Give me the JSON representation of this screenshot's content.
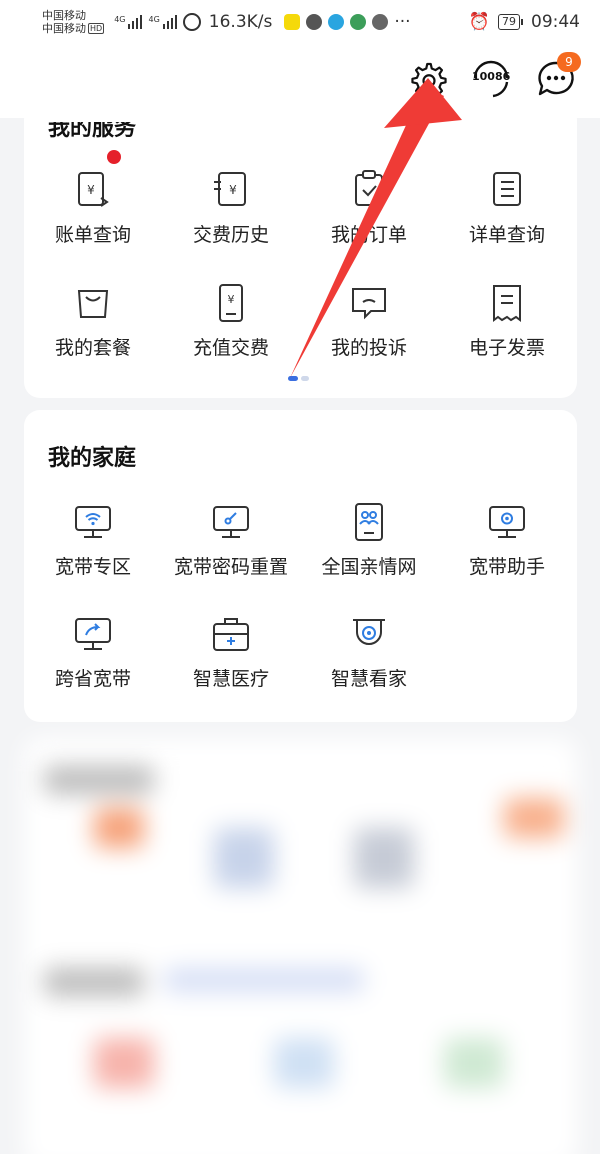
{
  "status_bar": {
    "carrier_1": "中国移动",
    "carrier_2": "中国移动",
    "hd_badge": "HD",
    "network_tag_1": "4G",
    "network_tag_2": "4G",
    "net_speed": "16.3K/s",
    "more": "···",
    "battery": "79",
    "time": "09:44"
  },
  "header": {
    "settings_icon": "gear-icon",
    "service_number": "10086",
    "message_badge": "9"
  },
  "my_services": {
    "title": "我的服务",
    "items": [
      {
        "label": "账单查询",
        "icon": "bill-icon"
      },
      {
        "label": "交费历史",
        "icon": "payment-history-icon"
      },
      {
        "label": "我的订单",
        "icon": "order-icon"
      },
      {
        "label": "详单查询",
        "icon": "detail-list-icon"
      },
      {
        "label": "我的套餐",
        "icon": "package-icon"
      },
      {
        "label": "充值交费",
        "icon": "recharge-icon"
      },
      {
        "label": "我的投诉",
        "icon": "complaint-icon"
      },
      {
        "label": "电子发票",
        "icon": "invoice-icon"
      }
    ]
  },
  "my_family": {
    "title": "我的家庭",
    "items": [
      {
        "label": "宽带专区",
        "icon": "broadband-zone-icon"
      },
      {
        "label": "宽带密码重置",
        "icon": "broadband-password-icon"
      },
      {
        "label": "全国亲情网",
        "icon": "family-network-icon"
      },
      {
        "label": "宽带助手",
        "icon": "broadband-assistant-icon"
      },
      {
        "label": "跨省宽带",
        "icon": "cross-province-broadband-icon"
      },
      {
        "label": "智慧医疗",
        "icon": "smart-medical-icon"
      },
      {
        "label": "智慧看家",
        "icon": "smart-home-camera-icon"
      }
    ]
  },
  "colors": {
    "accent": "#3b6fe0",
    "badge": "#f56a1f",
    "red_dot": "#e5202a",
    "arrow": "#ef3b36"
  }
}
